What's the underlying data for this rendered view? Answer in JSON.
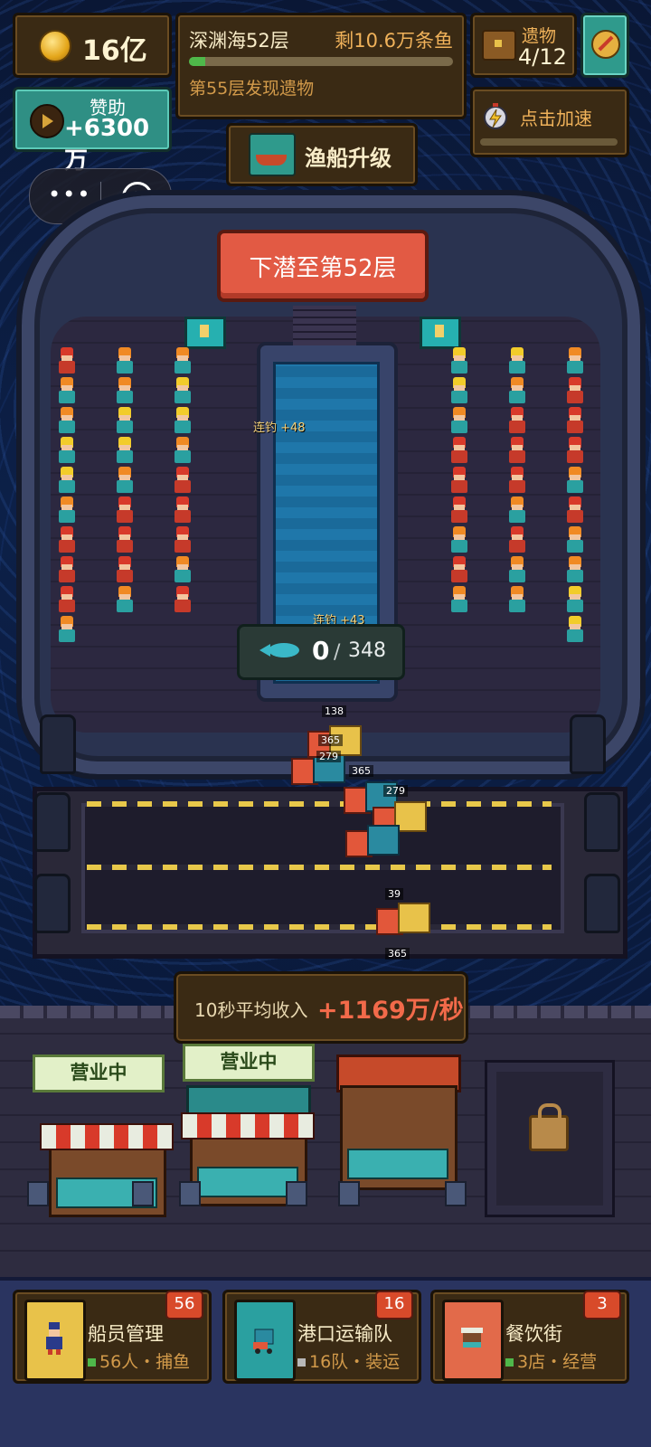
{
  "hud": {
    "gold": "16亿",
    "layer_name": "深渊海52层",
    "layer_remaining": "剩10.6万条鱼",
    "layer_progress": 0.06,
    "layer_tip": "第55层发现遗物",
    "relic_label": "遗物",
    "relic_count": "4/12",
    "sponsor_label": "赞助",
    "sponsor_value": "+6300万",
    "speed_label": "点击加速",
    "upgrade_label": "渔船升级"
  },
  "mini_program": {
    "more": "•••"
  },
  "ship": {
    "dive_label": "下潜至第52层",
    "combos": [
      "连钓 +48",
      "连钓 +43"
    ],
    "fish_current": "0",
    "fish_separator": "/",
    "fish_total": "348"
  },
  "pier": {
    "tags": [
      "138",
      "365",
      "279",
      "365",
      "279",
      "39",
      "365"
    ]
  },
  "income": {
    "label": "10秒平均收入",
    "value": "+1169万/秒"
  },
  "shops": [
    {
      "status": "营业中"
    },
    {
      "status": "营业中"
    }
  ],
  "tabs": [
    {
      "title": "船员管理",
      "badge": "56",
      "sub": "56人・捕鱼",
      "icon": "crew-icon",
      "sub_color": "#4fb84a"
    },
    {
      "title": "港口运输队",
      "badge": "16",
      "sub": "16队・装运",
      "icon": "truck-icon",
      "sub_color": "#b8b8b8"
    },
    {
      "title": "餐饮街",
      "badge": "3",
      "sub": "3店・经营",
      "icon": "shop-icon",
      "sub_color": "#4fb84a"
    }
  ]
}
